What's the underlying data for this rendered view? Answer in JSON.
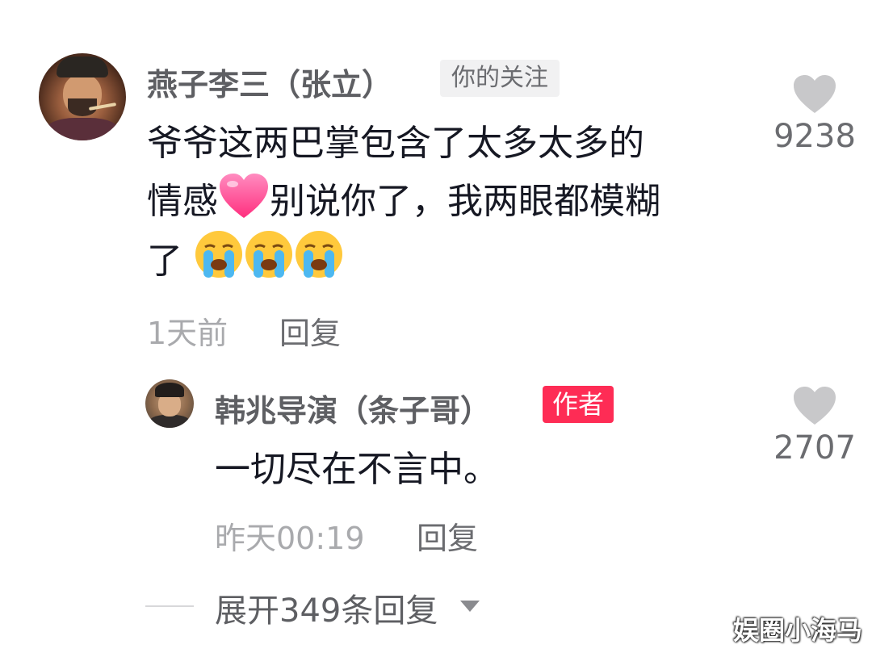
{
  "comment": {
    "username": "燕子李三（张立）",
    "follow_tag": "你的关注",
    "text_line1": "爷爷这两巴掌包含了太多太多的",
    "text_line2_a": "情感",
    "text_line2_b": "别说你了，我两眼都模糊",
    "text_line3": "了",
    "emoji_heart": "pink-heart",
    "emoji_cry": "loudly-crying-face",
    "time": "1天前",
    "reply_label": "回复",
    "like_count": "9238",
    "like_icon": "heart-icon"
  },
  "reply": {
    "username": "韩兆导演（条子哥）",
    "author_tag": "作者",
    "text": "一切尽在不言中。",
    "time": "昨天00:19",
    "reply_label": "回复",
    "like_count": "2707",
    "like_icon": "heart-icon"
  },
  "expand_replies": "展开349条回复",
  "watermark": "娱圈小海马",
  "colors": {
    "author_tag": "#fe2c55",
    "like_icon": "#c8c8ca",
    "username": "#5e5f63",
    "meta": "#a9aaad"
  }
}
